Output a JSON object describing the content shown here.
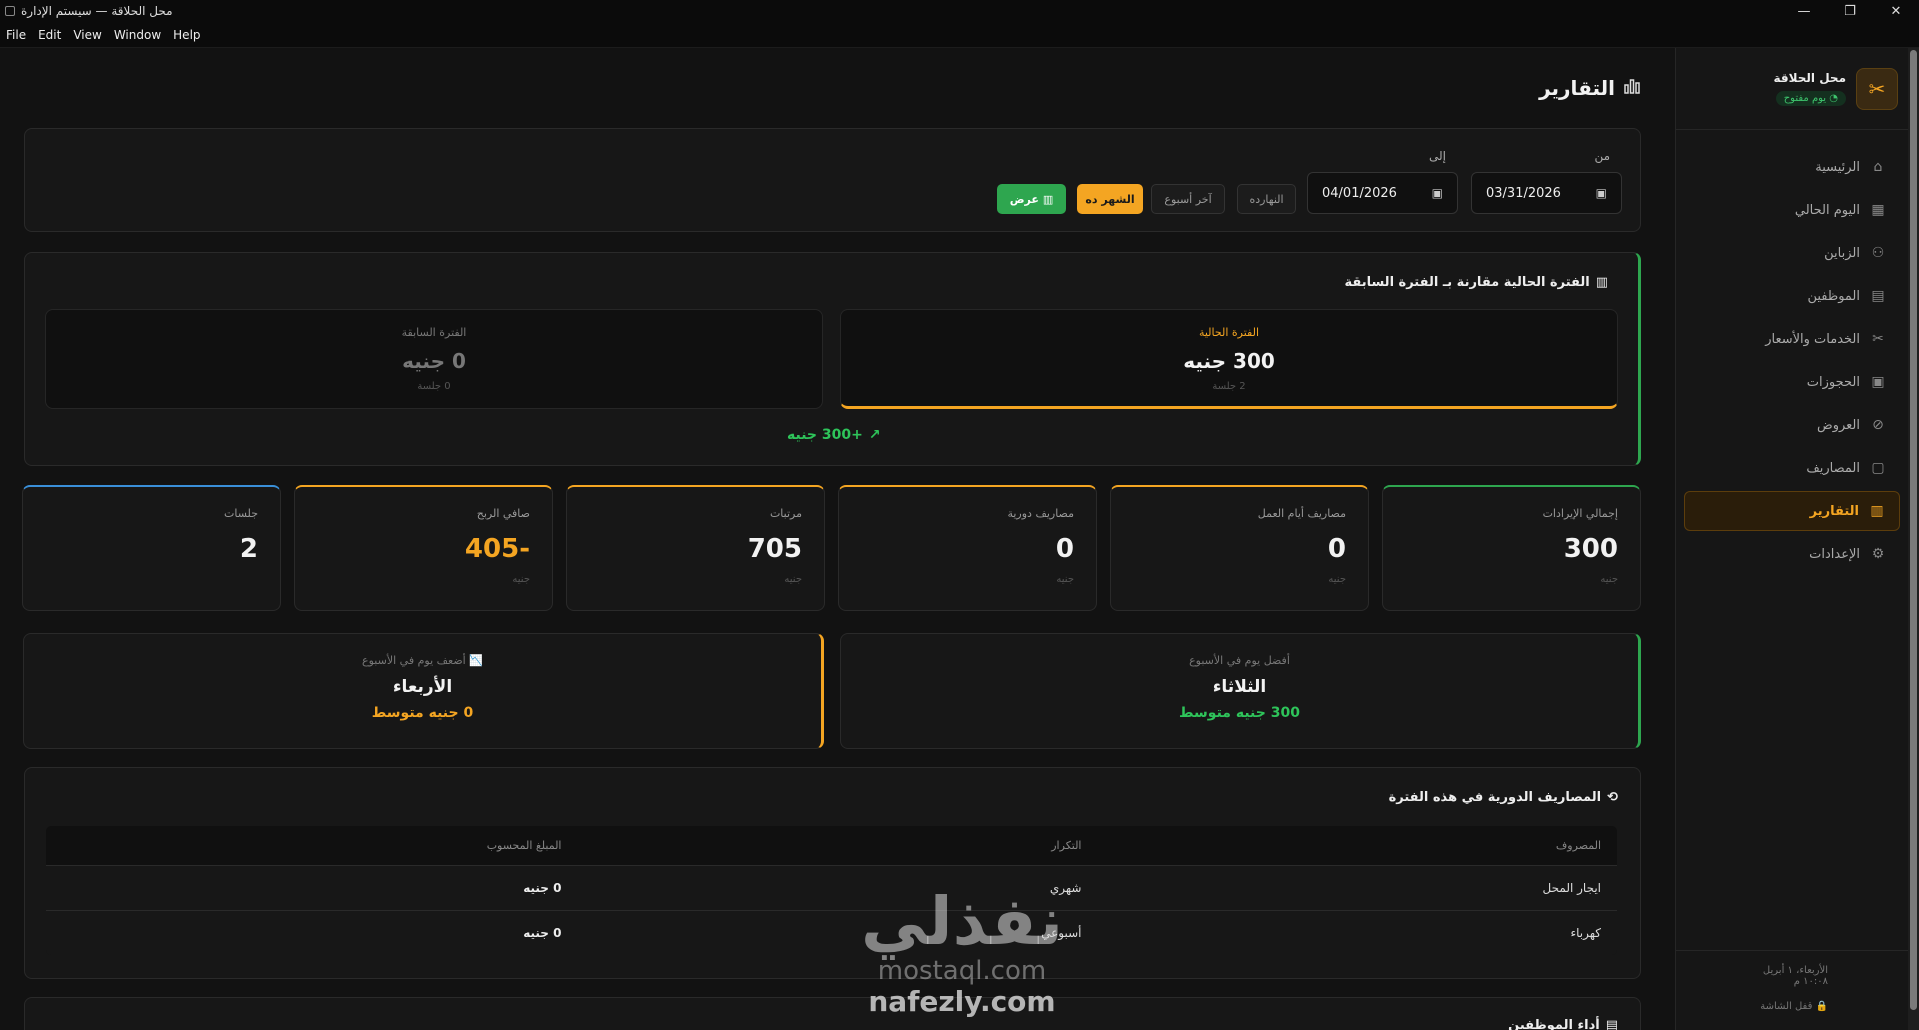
{
  "window": {
    "title": "محل الحلاقة — سيستم الإدارة",
    "minimize": "—",
    "maximize": "❐",
    "close": "✕"
  },
  "menu": [
    "File",
    "Edit",
    "View",
    "Window",
    "Help"
  ],
  "sidebar": {
    "brand_name": "محل الحلاقة",
    "brand_status": "يوم مفتوح",
    "items": [
      {
        "label": "الرئيسية",
        "icon": "home-icon"
      },
      {
        "label": "اليوم الحالي",
        "icon": "calendar-day-icon"
      },
      {
        "label": "الزباين",
        "icon": "users-icon"
      },
      {
        "label": "الموظفين",
        "icon": "id-card-icon"
      },
      {
        "label": "الخدمات والأسعار",
        "icon": "scissors-icon"
      },
      {
        "label": "الحجوزات",
        "icon": "bookings-icon"
      },
      {
        "label": "العروض",
        "icon": "tag-icon"
      },
      {
        "label": "المصاريف",
        "icon": "wallet-icon"
      },
      {
        "label": "التقارير",
        "icon": "bar-chart-icon",
        "active": true
      },
      {
        "label": "الإعدادات",
        "icon": "gear-icon"
      }
    ],
    "footer_date": "الأربعاء، ١ أبريل",
    "footer_time": "١٠:٠٨ م",
    "lock_label": "قفل الشاشة"
  },
  "page": {
    "title": "التقارير"
  },
  "filter": {
    "from_label": "من",
    "to_label": "إلى",
    "from_value": "03/31/2026",
    "to_value": "04/01/2026",
    "quick": {
      "today": "النهارده",
      "last_week": "آخر أسبوع",
      "this_month": "الشهر ده",
      "show": "عرض"
    }
  },
  "compare": {
    "title": "الفترة الحالية مقارنة بـ الفترة السابقة",
    "current": {
      "label": "الفترة الحالية",
      "value": "300 جنيه",
      "sessions": "2 جلسة"
    },
    "previous": {
      "label": "الفترة السابقة",
      "value": "0 جنيه",
      "sessions": "0 جلسة"
    },
    "diff": "+300 جنيه"
  },
  "stats": [
    {
      "label": "إجمالي الإيرادات",
      "value": "300",
      "unit": "جنيه",
      "accent": "#2ea64f"
    },
    {
      "label": "مصاريف أيام العمل",
      "value": "0",
      "unit": "جنيه",
      "accent": "#f4a522"
    },
    {
      "label": "مصاريف دورية",
      "value": "0",
      "unit": "جنيه",
      "accent": "#f4a522"
    },
    {
      "label": "مرتبات",
      "value": "705",
      "unit": "جنيه",
      "accent": "#f4a522"
    },
    {
      "label": "صافي الربح",
      "value": "-405",
      "unit": "جنيه",
      "accent": "#f4a522"
    },
    {
      "label": "جلسات",
      "value": "2",
      "unit": "",
      "accent": "#3a8fd8"
    }
  ],
  "days": {
    "best": {
      "label": "أفضل يوم في الأسبوع",
      "day": "الثلاثاء",
      "avg": "300 جنيه متوسط"
    },
    "worst": {
      "label": "أضعف يوم في الأسبوع",
      "day": "الأربعاء",
      "avg": "0 جنيه متوسط"
    }
  },
  "expenses": {
    "title": "المصاريف الدورية في هذه الفترة",
    "columns": [
      "المصروف",
      "التكرار",
      "المبلغ المحسوب"
    ],
    "rows": [
      [
        "ايجار المحل",
        "شهري",
        "0 جنيه"
      ],
      [
        "كهرباء",
        "أسبوعي",
        "0 جنيه"
      ]
    ]
  },
  "employees": {
    "title": "أداء الموظفين"
  },
  "watermark": {
    "arabic": "نفذلي",
    "line2": "mostaql.com",
    "line3": "nafezly.com"
  },
  "colors": {
    "accent_orange": "#f4a522",
    "accent_green": "#2ea64f",
    "accent_blue": "#3a8fd8",
    "background": "#121212"
  }
}
